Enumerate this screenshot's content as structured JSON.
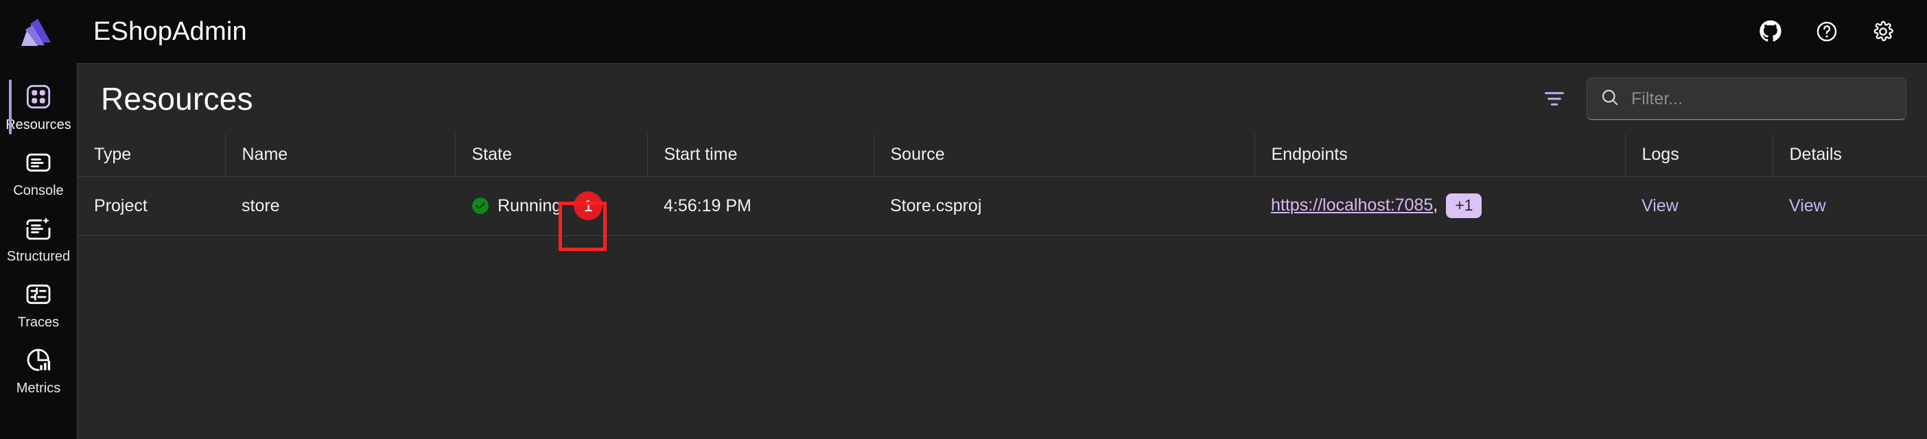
{
  "app": {
    "title": "EShopAdmin",
    "logo_icon": "aspire-logo-icon",
    "accent": "#b19ae0",
    "panel_bg": "#272727",
    "chrome_bg": "#0b0b0b"
  },
  "topbar": {
    "actions": [
      {
        "name": "github-icon",
        "label": "GitHub"
      },
      {
        "name": "help-icon",
        "label": "Help"
      },
      {
        "name": "gear-icon",
        "label": "Settings"
      }
    ]
  },
  "sidebar": {
    "items": [
      {
        "label": "Resources",
        "icon": "grid-icon",
        "active": true
      },
      {
        "label": "Console",
        "icon": "console-icon",
        "active": false
      },
      {
        "label": "Structured",
        "icon": "structured-icon",
        "active": false
      },
      {
        "label": "Traces",
        "icon": "traces-icon",
        "active": false
      },
      {
        "label": "Metrics",
        "icon": "metrics-icon",
        "active": false
      }
    ]
  },
  "page": {
    "title": "Resources",
    "filter_icon": "filter-icon"
  },
  "search": {
    "placeholder": "Filter...",
    "value": "",
    "icon": "search-icon"
  },
  "table": {
    "columns": [
      "Type",
      "Name",
      "State",
      "Start time",
      "Source",
      "Endpoints",
      "Logs",
      "Details"
    ],
    "rows": [
      {
        "type": "Project",
        "name": "store",
        "state": {
          "text": "Running",
          "icon": "status-running-check-icon",
          "color": "#0f8a18",
          "count_badge": "1",
          "count_badge_color": "#e01b24"
        },
        "start_time": "4:56:19 PM",
        "source": "Store.csproj",
        "endpoints": {
          "link": "https://localhost:7085",
          "separator": ",",
          "more_badge": "+1"
        },
        "logs": "View",
        "details": "View"
      }
    ]
  },
  "annotation": {
    "color": "#ff2020",
    "target": "state-count-badge"
  }
}
